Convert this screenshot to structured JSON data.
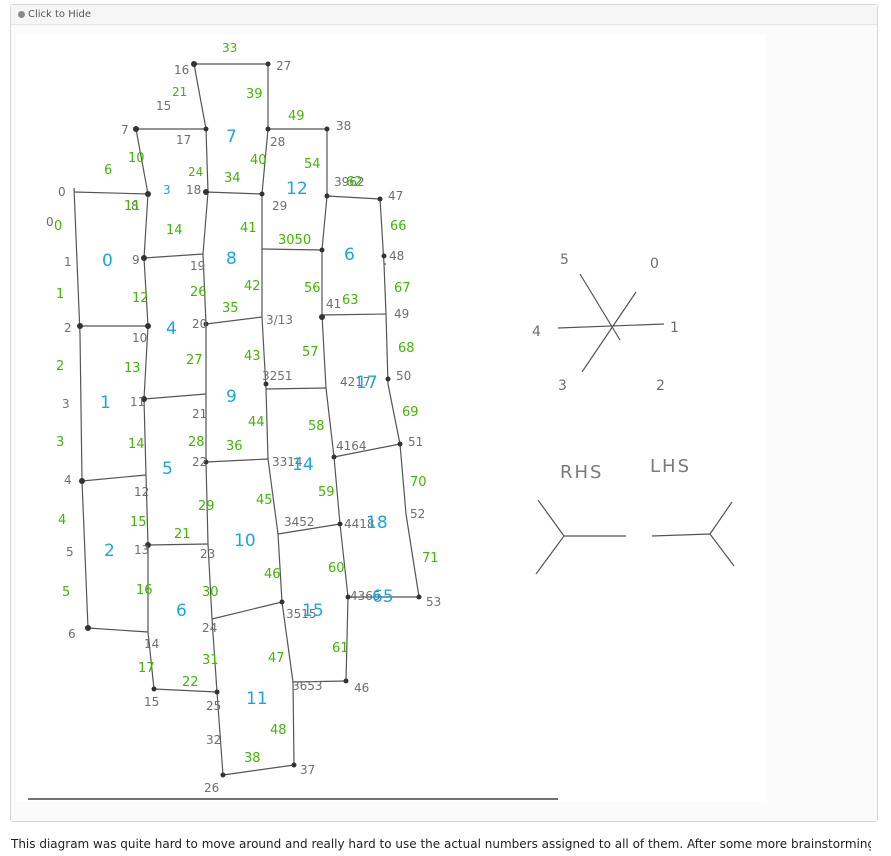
{
  "spoiler": {
    "toggle_label": "Click to Hide"
  },
  "diagram": {
    "colors": {
      "ink": "#555555",
      "green": "#3fb800",
      "blue": "#19a6e6",
      "gray": "#6f6f6f"
    },
    "gray_labels": [
      "16",
      "33",
      "27",
      "15",
      "21",
      "17",
      "7",
      "28",
      "38",
      "0",
      "8",
      "3",
      "18",
      "24",
      "29",
      "3962",
      "47",
      "1",
      "9",
      "19",
      "48",
      "2",
      "10",
      "20",
      "3/13",
      "41",
      "49",
      "3",
      "11",
      "21",
      "3251",
      "4217",
      "50",
      "4",
      "12",
      "22",
      "3314",
      "4164",
      "51",
      "5",
      "13",
      "23",
      "3452",
      "4418",
      "52",
      "6",
      "14",
      "24",
      "3515",
      "4365",
      "53",
      "15",
      "25",
      "3653",
      "46",
      "26",
      "32",
      "37",
      "0",
      "1",
      "2",
      "3",
      "4",
      "5",
      "6"
    ],
    "green_labels": [
      "33",
      "39",
      "49",
      "6",
      "10",
      "24",
      "34",
      "40",
      "54",
      "62",
      "11",
      "14",
      "25",
      "41",
      "3050",
      "66",
      "12",
      "26",
      "42",
      "35",
      "56",
      "63",
      "67",
      "13",
      "27",
      "43",
      "57",
      "68",
      "14",
      "28",
      "36",
      "44",
      "58",
      "69",
      "15",
      "29",
      "45",
      "59",
      "70",
      "16",
      "21",
      "30",
      "46",
      "60",
      "71",
      "17",
      "22",
      "31",
      "47",
      "61",
      "32",
      "48",
      "37",
      "38",
      "0",
      "1",
      "2",
      "3",
      "4",
      "5",
      "6"
    ],
    "blue_labels": [
      "7",
      "3",
      "12",
      "0",
      "8",
      "6",
      "4",
      "1",
      "9",
      "17",
      "5",
      "14",
      "2",
      "10",
      "18",
      "6",
      "15",
      "11",
      "65"
    ],
    "hex_labels": [
      "0",
      "1",
      "2",
      "3",
      "4",
      "5"
    ],
    "side_labels": {
      "rhs": "RHS",
      "lhs": "LHS"
    }
  },
  "caption": "This diagram was quite hard to move around and really hard to use the actual numbers assigned to all of them. After some more brainstorming, we came up with this."
}
